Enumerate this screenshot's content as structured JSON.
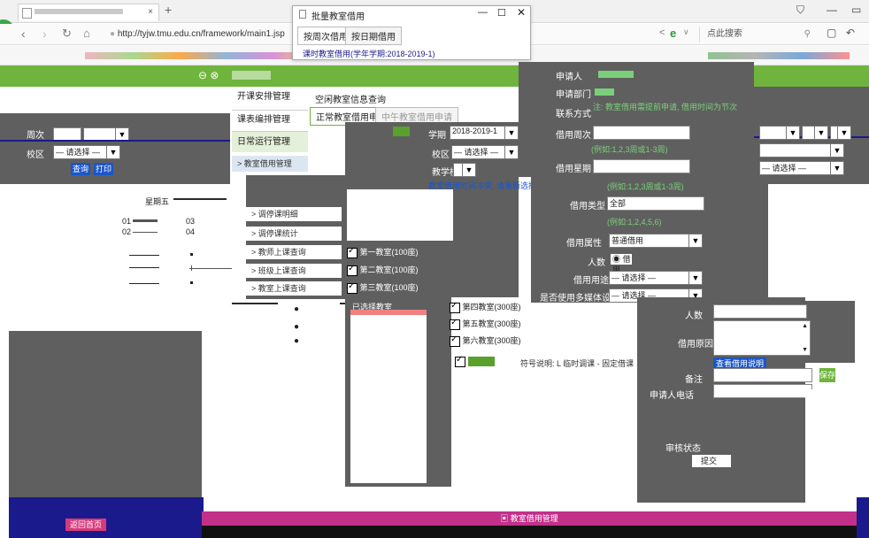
{
  "browser": {
    "tab_title": "",
    "url": "http://tyjw.tmu.edu.cn/framework/main1.jsp",
    "search_placeholder": "点此搜索"
  },
  "popup": {
    "title": "批量教室借用",
    "tabs": [
      "按周次借用",
      "按日期借用"
    ],
    "subtitle": "课时教室借用(学年学期:2018-2019-1)"
  },
  "app": {
    "menu": [
      "开课安排管理",
      "课表编排管理",
      "日常运行管理"
    ],
    "submenu": [
      "> 教室借用管理",
      "> 调停课明细",
      "> 调停课统计",
      "> 教师上课查询",
      "> 班级上课查询",
      "> 教室上课查询"
    ],
    "tab_active": "空闲教室信息查询",
    "subtabs": [
      "正常教室借用申请",
      "中午教室借用申请"
    ],
    "semester_label": "学期",
    "semester_value": "2018-2019-1",
    "campus_label": "校区",
    "building_label": "教学楼",
    "room_value": "— 请选择 —",
    "week_label": "周次",
    "weekday": "星期五",
    "periods": [
      "01",
      "02",
      "03",
      "04"
    ],
    "query_btn": "查询",
    "print_btn": "打印",
    "warning": "教室借用时间冲突, 请重新选择",
    "rooms": [
      {
        "name": "第一教室(100座)",
        "checked": true
      },
      {
        "name": "第二教室(100座)",
        "checked": true
      },
      {
        "name": "第三教室(100座)",
        "checked": true
      },
      {
        "name": "第四教室(300座)",
        "checked": true
      },
      {
        "name": "第五教室(300座)",
        "checked": true
      },
      {
        "name": "第六教室(300座)",
        "checked": true
      }
    ],
    "selected_label": "已选择教室",
    "legend": "符号说明: L 临时调课 - 固定借课",
    "bottom_title": "教室借用管理",
    "bottom_btn": "返回首页"
  },
  "form": {
    "applicant_label": "申请人",
    "dept_label": "申请部门",
    "contact_label": "联系方式",
    "note_red": "注: 教室借用需提前申请, 借用时间为节次",
    "weeks_label": "借用周次",
    "weeks_hint": "(例如:1,2,3周或1-3周)",
    "days_label": "借用星期",
    "days_value": "全部",
    "days_hint": "(例如:1,2,4,5,6)",
    "type_label": "借用类型",
    "type_value": "普通借用",
    "attr_label": "借用属性",
    "attr_value": "借用",
    "purpose_label": "借用用途",
    "purpose_value": "— 请选择 —",
    "category_label": "是否使用多媒体设备",
    "category_value": "— 请选择 —",
    "people_label": "人数",
    "reason_label": "借用原因",
    "remark_label": "备注",
    "remark_link": "查看借用说明",
    "phone_label": "申请人电话",
    "save_btn": "保存",
    "auth_label": "审核状态",
    "submit_btn": "提交"
  },
  "colors": {
    "green": "#6fb43c",
    "gray": "#5f5f5f",
    "blue": "#1a56c9",
    "purple": "#c2308a",
    "navy": "#1a1a8c"
  }
}
